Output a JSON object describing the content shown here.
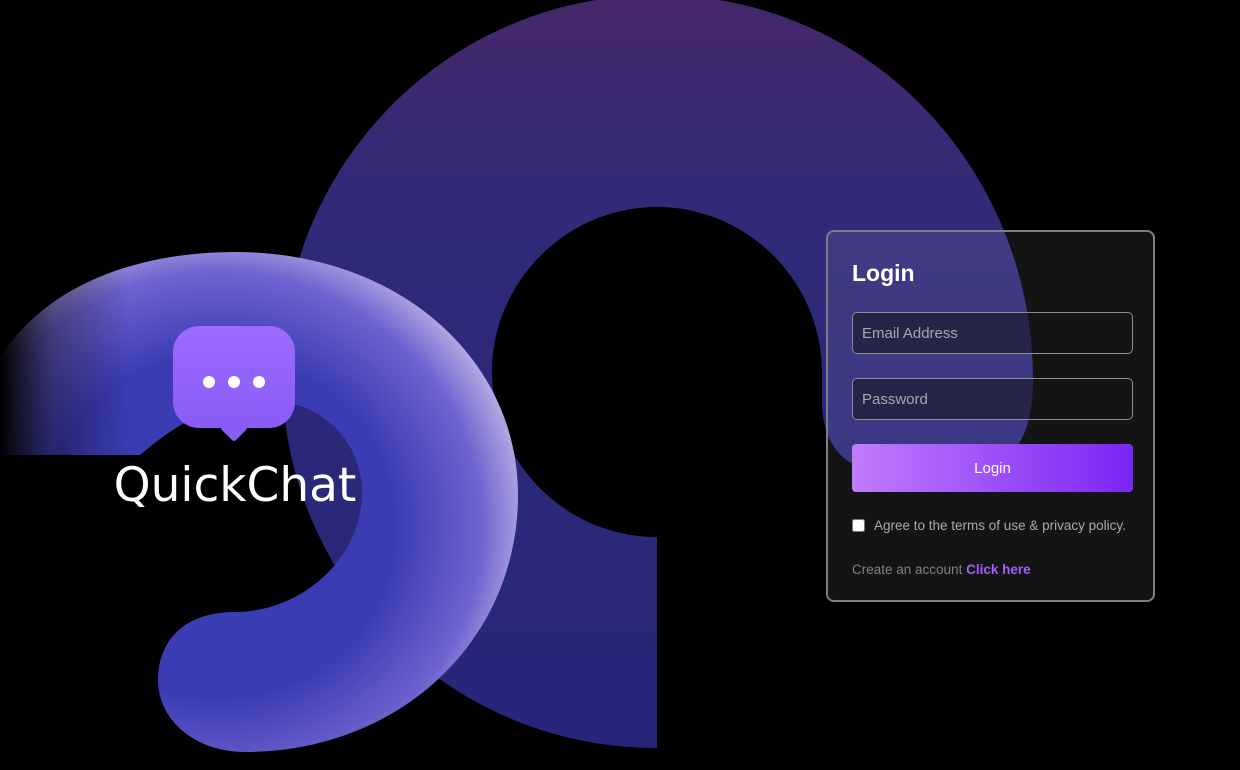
{
  "brand": {
    "name": "QuickChat",
    "logo_icon": "chat-bubble-icon"
  },
  "login_card": {
    "title": "Login",
    "email_placeholder": "Email Address",
    "password_placeholder": "Password",
    "login_button_label": "Login",
    "agree_text": "Agree to the terms of use & privacy policy.",
    "create_account_text": "Create an account",
    "create_account_link": "Click here"
  },
  "colors": {
    "accent": "#8a5cf6",
    "button_gradient_start": "#c07cfb",
    "button_gradient_end": "#7a26f5",
    "link": "#a55bff",
    "background": "#000000",
    "shape_blue": "#2c2b7a"
  }
}
